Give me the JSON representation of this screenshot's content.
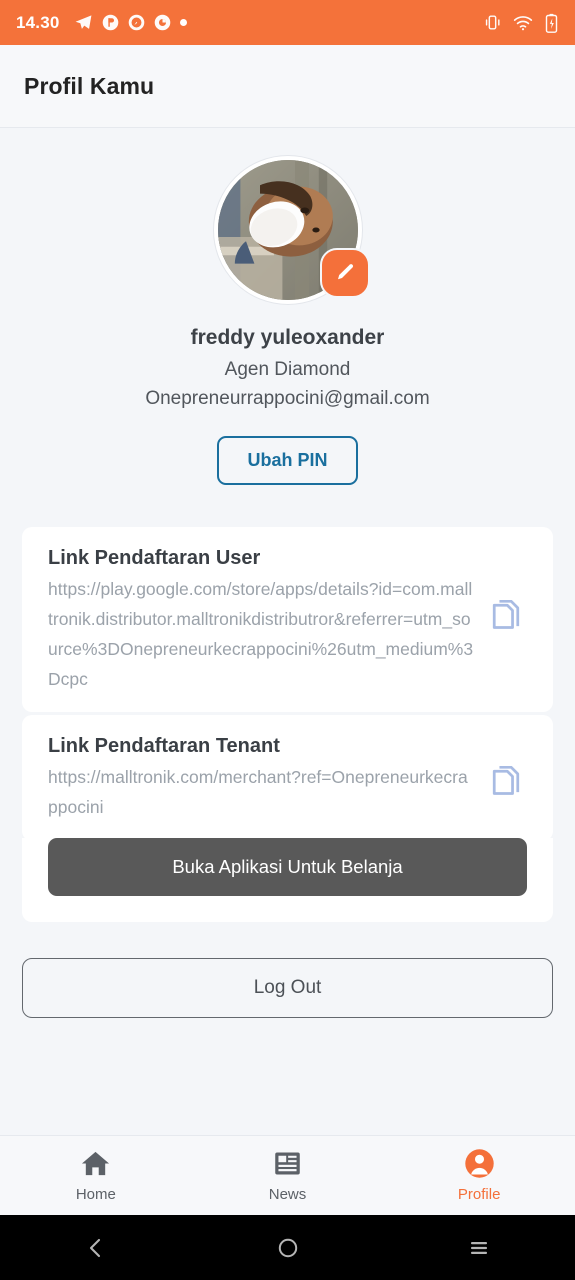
{
  "status_bar": {
    "time": "14.30",
    "left_icons": [
      "telegram-icon",
      "app-circle-icon-1",
      "app-circle-icon-2",
      "app-circle-icon-3",
      "notification-dot-icon"
    ],
    "right_icons": [
      "vibrate-icon",
      "wifi-icon",
      "battery-charging-icon"
    ],
    "background_color": "#f4723a"
  },
  "header": {
    "title": "Profil Kamu"
  },
  "profile": {
    "avatar_alt": "user-profile-photo",
    "edit_icon": "pencil-icon",
    "name": "freddy yuleoxander",
    "role": "Agen Diamond",
    "email": "Onepreneurrappocini@gmail.com",
    "pin_button_label": "Ubah PIN",
    "pin_button_color": "#1a6f9e",
    "accent_color": "#f4703a"
  },
  "cards": [
    {
      "title": "Link Pendaftaran User",
      "link": "https://play.google.com/store/apps/details?id=com.malltronik.distributor.malltronikdistributror&referrer=utm_source%3DOnepreneurkecrappocini%26utm_medium%3Dcpc",
      "copy_icon": "copy-icon"
    },
    {
      "title": "Link Pendaftaran Tenant",
      "link": "https://malltronik.com/merchant?ref=Onepreneurkecrappocini",
      "copy_icon": "copy-icon"
    }
  ],
  "shop_button": {
    "label": "Buka Aplikasi Untuk Belanja",
    "color": "#595959"
  },
  "logout_button": {
    "label": "Log Out"
  },
  "bottom_nav": {
    "items": [
      {
        "label": "Home",
        "icon": "home-icon",
        "active": false
      },
      {
        "label": "News",
        "icon": "news-icon",
        "active": false
      },
      {
        "label": "Profile",
        "icon": "profile-icon",
        "active": true
      }
    ],
    "active_color": "#f4703a"
  },
  "android_nav": {
    "back": "back-chevron-icon",
    "home": "home-circle-icon",
    "recents": "recents-menu-icon"
  }
}
